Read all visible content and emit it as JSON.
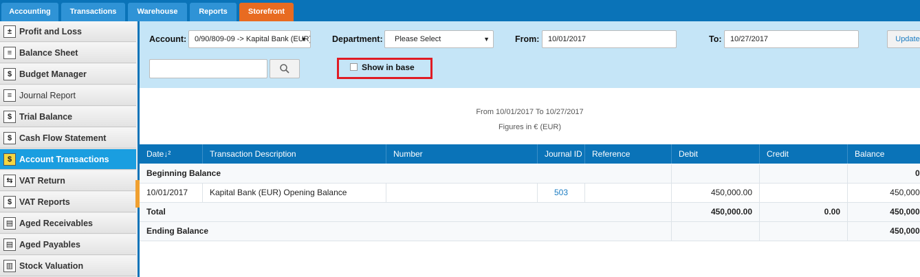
{
  "tabs": [
    {
      "label": "Accounting"
    },
    {
      "label": "Transactions"
    },
    {
      "label": "Warehouse"
    },
    {
      "label": "Reports"
    },
    {
      "label": "Storefront"
    }
  ],
  "sidebar": {
    "items": [
      {
        "label": "Profit and Loss",
        "icon": "ledger-icon"
      },
      {
        "label": "Balance Sheet",
        "icon": "sheet-icon"
      },
      {
        "label": "Budget Manager",
        "icon": "money-icon"
      },
      {
        "label": "Journal Report",
        "icon": "journal-icon"
      },
      {
        "label": "Trial Balance",
        "icon": "dollar-icon"
      },
      {
        "label": "Cash Flow Statement",
        "icon": "dollar-icon"
      },
      {
        "label": "Account Transactions",
        "icon": "account-icon",
        "active": true
      },
      {
        "label": "VAT Return",
        "icon": "return-icon"
      },
      {
        "label": "VAT Reports",
        "icon": "money-icon"
      },
      {
        "label": "Aged Receivables",
        "icon": "cash-icon"
      },
      {
        "label": "Aged Payables",
        "icon": "cash-icon"
      },
      {
        "label": "Stock Valuation",
        "icon": "stock-icon"
      }
    ]
  },
  "filters": {
    "account_label": "Account:",
    "account_value": "0/90/809-09 -> Kapital Bank  (EUR)",
    "department_label": "Department:",
    "department_value": "Please Select",
    "from_label": "From:",
    "from_value": "10/01/2017",
    "to_label": "To:",
    "to_value": "10/27/2017",
    "update_label": "Update",
    "search_placeholder": "",
    "show_in_base_label": "Show in base"
  },
  "report": {
    "period": "From 10/01/2017 To 10/27/2017",
    "currency": "Figures in € (EUR)"
  },
  "table": {
    "headers": [
      "Date",
      "Transaction Description",
      "Number",
      "Journal ID",
      "Reference",
      "Debit",
      "Credit",
      "Balance"
    ],
    "beginning_label": "Beginning Balance",
    "beginning_balance": "0.",
    "rows": [
      {
        "date": "10/01/2017",
        "description": "Kapital Bank (EUR) Opening Balance",
        "number": "",
        "journal_id": "503",
        "reference": "",
        "debit": "450,000.00",
        "credit": "",
        "balance": "450,000."
      }
    ],
    "total_label": "Total",
    "total_debit": "450,000.00",
    "total_credit": "0.00",
    "total_balance": "450,000.",
    "ending_label": "Ending Balance",
    "ending_balance": "450,000."
  },
  "colors": {
    "accent": "#0a73b8",
    "active_tab": "#e86b21",
    "highlight": "#e01b24"
  }
}
